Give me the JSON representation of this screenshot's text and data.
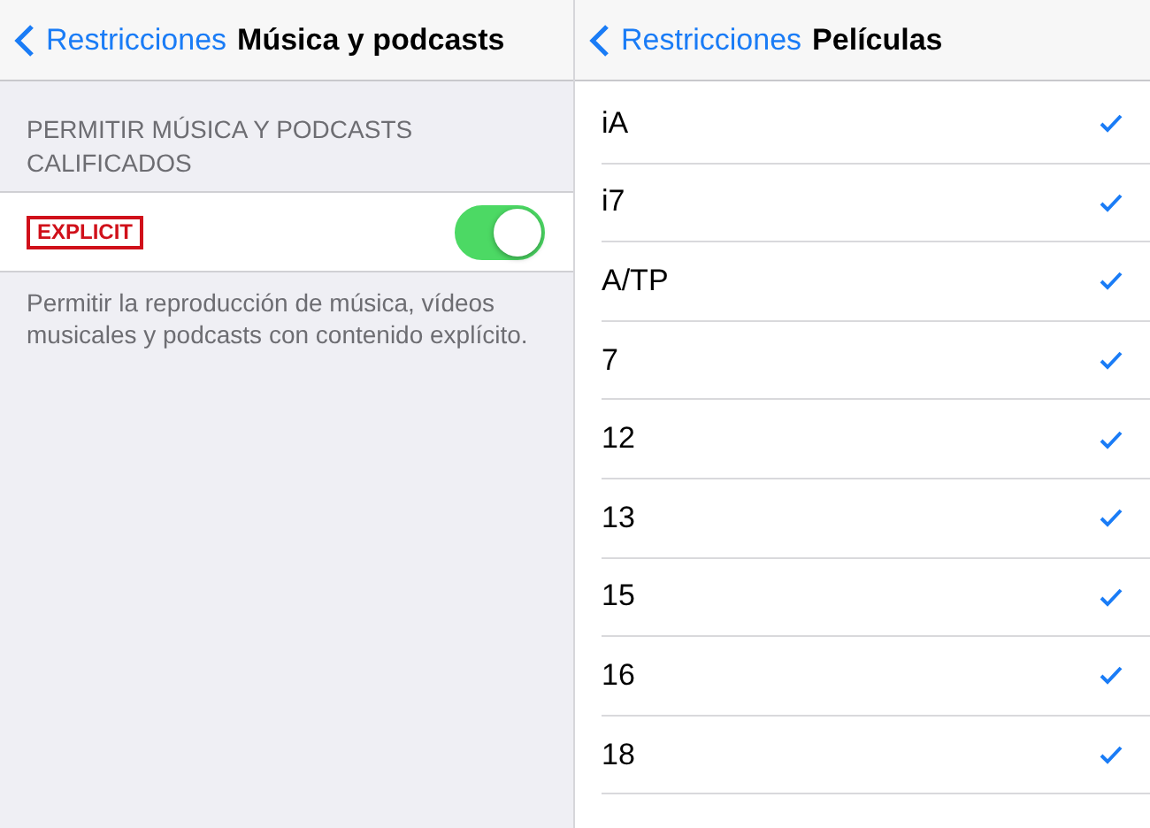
{
  "left": {
    "back": "Restricciones",
    "title": "Música y podcasts",
    "section_header": "PERMITIR MÚSICA Y PODCASTS CALIFICADOS",
    "toggle_row": {
      "badge": "EXPLICIT",
      "on": true
    },
    "footer": "Permitir la reproducción de música, vídeos musicales y podcasts con contenido explícito."
  },
  "right": {
    "back": "Restricciones",
    "title": "Películas",
    "ratings": [
      {
        "label": "iA",
        "checked": true
      },
      {
        "label": "i7",
        "checked": true
      },
      {
        "label": "A/TP",
        "checked": true
      },
      {
        "label": "7",
        "checked": true
      },
      {
        "label": "12",
        "checked": true
      },
      {
        "label": "13",
        "checked": true
      },
      {
        "label": "15",
        "checked": true
      },
      {
        "label": "16",
        "checked": true
      },
      {
        "label": "18",
        "checked": true
      }
    ]
  }
}
